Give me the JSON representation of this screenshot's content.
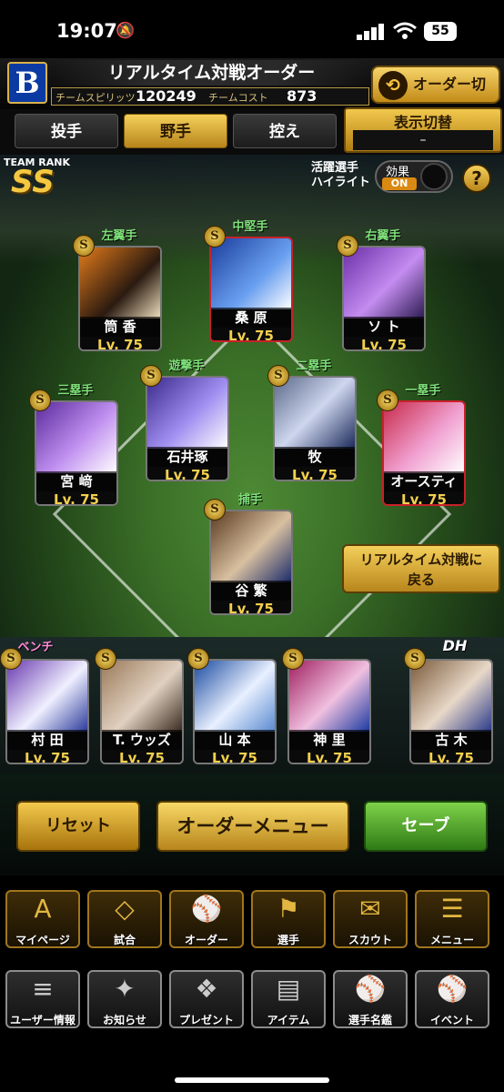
{
  "status": {
    "time": "19:07",
    "battery": "55"
  },
  "header": {
    "title": "リアルタイム対戦オーダー",
    "team_spirits_label": "チームスピリッツ",
    "team_spirits_value": "120249",
    "team_cost_label": "チームコスト",
    "team_cost_value": "873",
    "order_switch": "オーダー切替"
  },
  "tabs": [
    {
      "label": "投手"
    },
    {
      "label": "野手",
      "active": true
    },
    {
      "label": "控え"
    }
  ],
  "display_switch": {
    "label": "表示切替",
    "value": "–"
  },
  "team_rank": {
    "label": "TEAM RANK",
    "value": "SS"
  },
  "highlight": {
    "line1": "活躍選手",
    "line2": "ハイライト",
    "effect_label": "効果",
    "effect_state": "ON",
    "help": "?"
  },
  "field_players": [
    {
      "pos": "左翼手",
      "name": "筒 香",
      "level": "Lv. 75",
      "badge": "S"
    },
    {
      "pos": "中堅手",
      "name": "桑 原",
      "level": "Lv. 75",
      "badge": "S"
    },
    {
      "pos": "右翼手",
      "name": "ソ ト",
      "level": "Lv. 75",
      "badge": "S"
    },
    {
      "pos": "遊撃手",
      "name": "石井琢",
      "level": "Lv. 75",
      "badge": "S"
    },
    {
      "pos": "二塁手",
      "name": "牧",
      "level": "Lv. 75",
      "badge": "S"
    },
    {
      "pos": "三塁手",
      "name": "宮 﨑",
      "level": "Lv. 75",
      "badge": "S"
    },
    {
      "pos": "一塁手",
      "name": "オースティン",
      "level": "Lv. 75",
      "badge": "S"
    },
    {
      "pos": "捕手",
      "name": "谷 繁",
      "level": "Lv. 75",
      "badge": "S"
    }
  ],
  "return_button": {
    "line1": "リアルタイム対戦に",
    "line2": "戻る"
  },
  "bench": {
    "label": "ベンチ",
    "dh_label": "DH"
  },
  "bench_players": [
    {
      "name": "村 田",
      "level": "Lv. 75",
      "badge": "S"
    },
    {
      "name": "T. ウッズ",
      "level": "Lv. 75",
      "badge": "S"
    },
    {
      "name": "山 本",
      "level": "Lv. 75",
      "badge": "S"
    },
    {
      "name": "神 里",
      "level": "Lv. 75",
      "badge": "S"
    },
    {
      "name": "古 木",
      "level": "Lv. 75",
      "badge": "S"
    }
  ],
  "actions": {
    "reset": "リセット",
    "order_menu": "オーダーメニュー",
    "save": "セーブ"
  },
  "nav_row1": [
    {
      "label": "マイページ",
      "icon": "A"
    },
    {
      "label": "試合",
      "icon": "◇"
    },
    {
      "label": "オーダー",
      "icon": "⚾"
    },
    {
      "label": "選手",
      "icon": "⚑"
    },
    {
      "label": "スカウト",
      "icon": "✉"
    },
    {
      "label": "メニュー",
      "icon": "☰"
    }
  ],
  "nav_row2": [
    {
      "label": "ユーザー情報",
      "icon": "≡"
    },
    {
      "label": "お知らせ",
      "icon": "✦"
    },
    {
      "label": "プレゼント",
      "icon": "❖"
    },
    {
      "label": "アイテム",
      "icon": "▤"
    },
    {
      "label": "選手名鑑",
      "icon": "⚾"
    },
    {
      "label": "イベント",
      "icon": "⚾"
    }
  ]
}
